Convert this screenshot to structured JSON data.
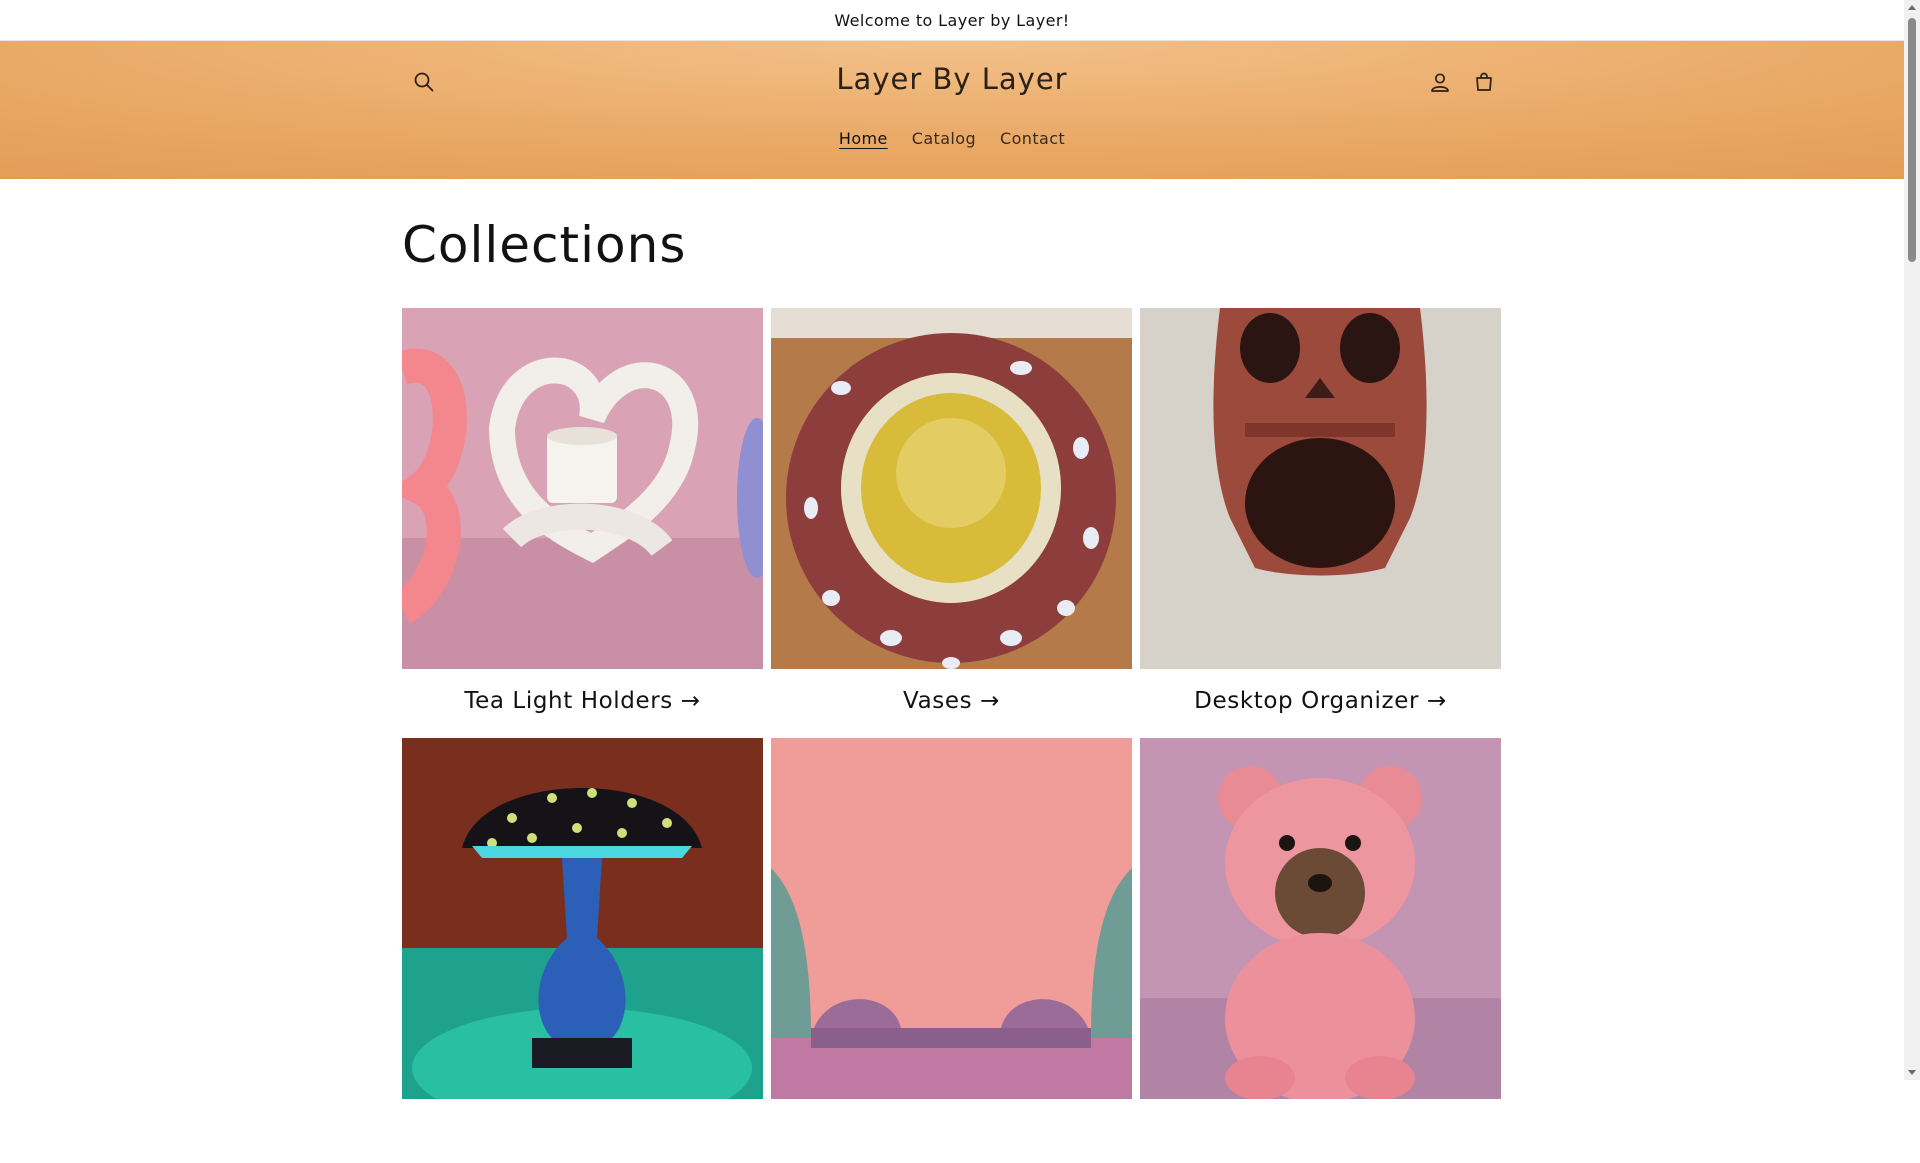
{
  "announcement": {
    "text": "Welcome to Layer by Layer!"
  },
  "header": {
    "brand": "Layer By Layer",
    "icons": {
      "search": "search-icon",
      "account": "account-icon",
      "cart": "cart-icon"
    },
    "nav": [
      {
        "label": "Home",
        "active": true
      },
      {
        "label": "Catalog",
        "active": false
      },
      {
        "label": "Contact",
        "active": false
      }
    ]
  },
  "main": {
    "title": "Collections",
    "collections": [
      {
        "label": "Tea Light Holders →",
        "image": "white and pink heart-shaped tea light holders on pink background"
      },
      {
        "label": "Vases →",
        "image": "red spotted mushroom-style vase top view"
      },
      {
        "label": "Desktop Organizer →",
        "image": "red skull desktop organizer"
      },
      {
        "label": "",
        "image": "glowing mushroom lamp"
      },
      {
        "label": "",
        "image": "gnome bookends on pink wall"
      },
      {
        "label": "",
        "image": "pink rose teddy bear"
      }
    ]
  },
  "colors": {
    "header_gradient_light": "#f3c189",
    "header_gradient_dark": "#e09a52",
    "text": "#121212"
  }
}
